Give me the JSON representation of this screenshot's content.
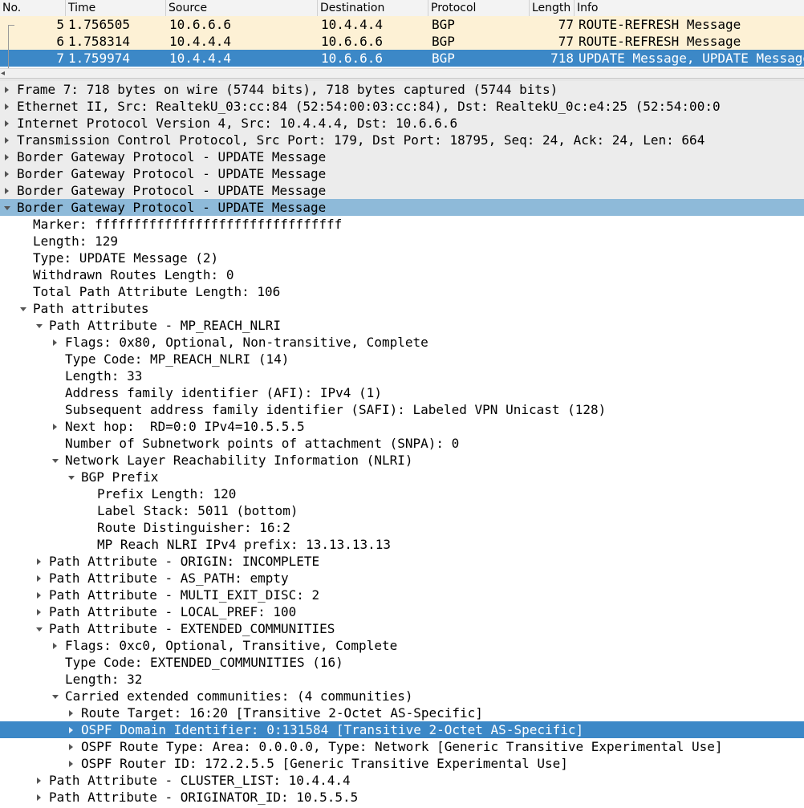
{
  "packet_list": {
    "columns": [
      "No.",
      "Time",
      "Source",
      "Destination",
      "Protocol",
      "Length",
      "Info"
    ],
    "rows": [
      {
        "no": "5",
        "time": "1.756505",
        "source": "10.6.6.6",
        "destination": "10.4.4.4",
        "protocol": "BGP",
        "length": "77",
        "info": "ROUTE-REFRESH Message"
      },
      {
        "no": "6",
        "time": "1.758314",
        "source": "10.4.4.4",
        "destination": "10.6.6.6",
        "protocol": "BGP",
        "length": "77",
        "info": "ROUTE-REFRESH Message"
      },
      {
        "no": "7",
        "time": "1.759974",
        "source": "10.4.4.4",
        "destination": "10.6.6.6",
        "protocol": "BGP",
        "length": "718",
        "info": "UPDATE Message, UPDATE Message, UPDATE Message, UPDATE Message"
      }
    ],
    "selected_row": 2,
    "scroll_arrow_icon": "scroll-left-arrow"
  },
  "details": {
    "rows": [
      {
        "text": "Frame 7: 718 bytes on wire (5744 bits), 718 bytes captured (5744 bits)",
        "level": 0,
        "state": "collapsed",
        "style": "gray"
      },
      {
        "text": "Ethernet II, Src: RealtekU_03:cc:84 (52:54:00:03:cc:84), Dst: RealtekU_0c:e4:25 (52:54:00:0",
        "level": 0,
        "state": "collapsed",
        "style": "gray"
      },
      {
        "text": "Internet Protocol Version 4, Src: 10.4.4.4, Dst: 10.6.6.6",
        "level": 0,
        "state": "collapsed",
        "style": "gray"
      },
      {
        "text": "Transmission Control Protocol, Src Port: 179, Dst Port: 18795, Seq: 24, Ack: 24, Len: 664",
        "level": 0,
        "state": "collapsed",
        "style": "gray"
      },
      {
        "text": "Border Gateway Protocol - UPDATE Message",
        "level": 0,
        "state": "collapsed",
        "style": "gray"
      },
      {
        "text": "Border Gateway Protocol - UPDATE Message",
        "level": 0,
        "state": "collapsed",
        "style": "gray"
      },
      {
        "text": "Border Gateway Protocol - UPDATE Message",
        "level": 0,
        "state": "collapsed",
        "style": "gray"
      },
      {
        "text": "Border Gateway Protocol - UPDATE Message",
        "level": 0,
        "state": "expanded",
        "style": "highlight"
      },
      {
        "text": "Marker: ffffffffffffffffffffffffffffffff",
        "level": 1,
        "state": "leaf",
        "style": ""
      },
      {
        "text": "Length: 129",
        "level": 1,
        "state": "leaf",
        "style": ""
      },
      {
        "text": "Type: UPDATE Message (2)",
        "level": 1,
        "state": "leaf",
        "style": ""
      },
      {
        "text": "Withdrawn Routes Length: 0",
        "level": 1,
        "state": "leaf",
        "style": ""
      },
      {
        "text": "Total Path Attribute Length: 106",
        "level": 1,
        "state": "leaf",
        "style": ""
      },
      {
        "text": "Path attributes",
        "level": 1,
        "state": "expanded",
        "style": ""
      },
      {
        "text": "Path Attribute - MP_REACH_NLRI",
        "level": 2,
        "state": "expanded",
        "style": ""
      },
      {
        "text": "Flags: 0x80, Optional, Non-transitive, Complete",
        "level": 3,
        "state": "collapsed",
        "style": ""
      },
      {
        "text": "Type Code: MP_REACH_NLRI (14)",
        "level": 3,
        "state": "leaf",
        "style": ""
      },
      {
        "text": "Length: 33",
        "level": 3,
        "state": "leaf",
        "style": ""
      },
      {
        "text": "Address family identifier (AFI): IPv4 (1)",
        "level": 3,
        "state": "leaf",
        "style": ""
      },
      {
        "text": "Subsequent address family identifier (SAFI): Labeled VPN Unicast (128)",
        "level": 3,
        "state": "leaf",
        "style": ""
      },
      {
        "text": "Next hop:  RD=0:0 IPv4=10.5.5.5",
        "level": 3,
        "state": "collapsed",
        "style": ""
      },
      {
        "text": "Number of Subnetwork points of attachment (SNPA): 0",
        "level": 3,
        "state": "leaf",
        "style": ""
      },
      {
        "text": "Network Layer Reachability Information (NLRI)",
        "level": 3,
        "state": "expanded",
        "style": ""
      },
      {
        "text": "BGP Prefix",
        "level": 4,
        "state": "expanded",
        "style": ""
      },
      {
        "text": "Prefix Length: 120",
        "level": 5,
        "state": "leaf",
        "style": ""
      },
      {
        "text": "Label Stack: 5011 (bottom)",
        "level": 5,
        "state": "leaf",
        "style": ""
      },
      {
        "text": "Route Distinguisher: 16:2",
        "level": 5,
        "state": "leaf",
        "style": ""
      },
      {
        "text": "MP Reach NLRI IPv4 prefix: 13.13.13.13",
        "level": 5,
        "state": "leaf",
        "style": ""
      },
      {
        "text": "Path Attribute - ORIGIN: INCOMPLETE",
        "level": 2,
        "state": "collapsed",
        "style": ""
      },
      {
        "text": "Path Attribute - AS_PATH: empty",
        "level": 2,
        "state": "collapsed",
        "style": ""
      },
      {
        "text": "Path Attribute - MULTI_EXIT_DISC: 2",
        "level": 2,
        "state": "collapsed",
        "style": ""
      },
      {
        "text": "Path Attribute - LOCAL_PREF: 100",
        "level": 2,
        "state": "collapsed",
        "style": ""
      },
      {
        "text": "Path Attribute - EXTENDED_COMMUNITIES",
        "level": 2,
        "state": "expanded",
        "style": ""
      },
      {
        "text": "Flags: 0xc0, Optional, Transitive, Complete",
        "level": 3,
        "state": "collapsed",
        "style": ""
      },
      {
        "text": "Type Code: EXTENDED_COMMUNITIES (16)",
        "level": 3,
        "state": "leaf",
        "style": ""
      },
      {
        "text": "Length: 32",
        "level": 3,
        "state": "leaf",
        "style": ""
      },
      {
        "text": "Carried extended communities: (4 communities)",
        "level": 3,
        "state": "expanded",
        "style": ""
      },
      {
        "text": "Route Target: 16:20 [Transitive 2-Octet AS-Specific]",
        "level": 4,
        "state": "collapsed",
        "style": ""
      },
      {
        "text": "OSPF Domain Identifier: 0:131584 [Transitive 2-Octet AS-Specific]",
        "level": 4,
        "state": "collapsed",
        "style": "selected"
      },
      {
        "text": "OSPF Route Type: Area: 0.0.0.0, Type: Network [Generic Transitive Experimental Use]",
        "level": 4,
        "state": "collapsed",
        "style": ""
      },
      {
        "text": "OSPF Router ID: 172.2.5.5 [Generic Transitive Experimental Use]",
        "level": 4,
        "state": "collapsed",
        "style": ""
      },
      {
        "text": "Path Attribute - CLUSTER_LIST: 10.4.4.4",
        "level": 2,
        "state": "collapsed",
        "style": ""
      },
      {
        "text": "Path Attribute - ORIGINATOR_ID: 10.5.5.5",
        "level": 2,
        "state": "collapsed",
        "style": ""
      }
    ]
  },
  "colors": {
    "bgp_row": "#fdf1d5",
    "selection": "#3c88c7",
    "highlight": "#8ebad9",
    "tree_gray": "#ececec"
  }
}
